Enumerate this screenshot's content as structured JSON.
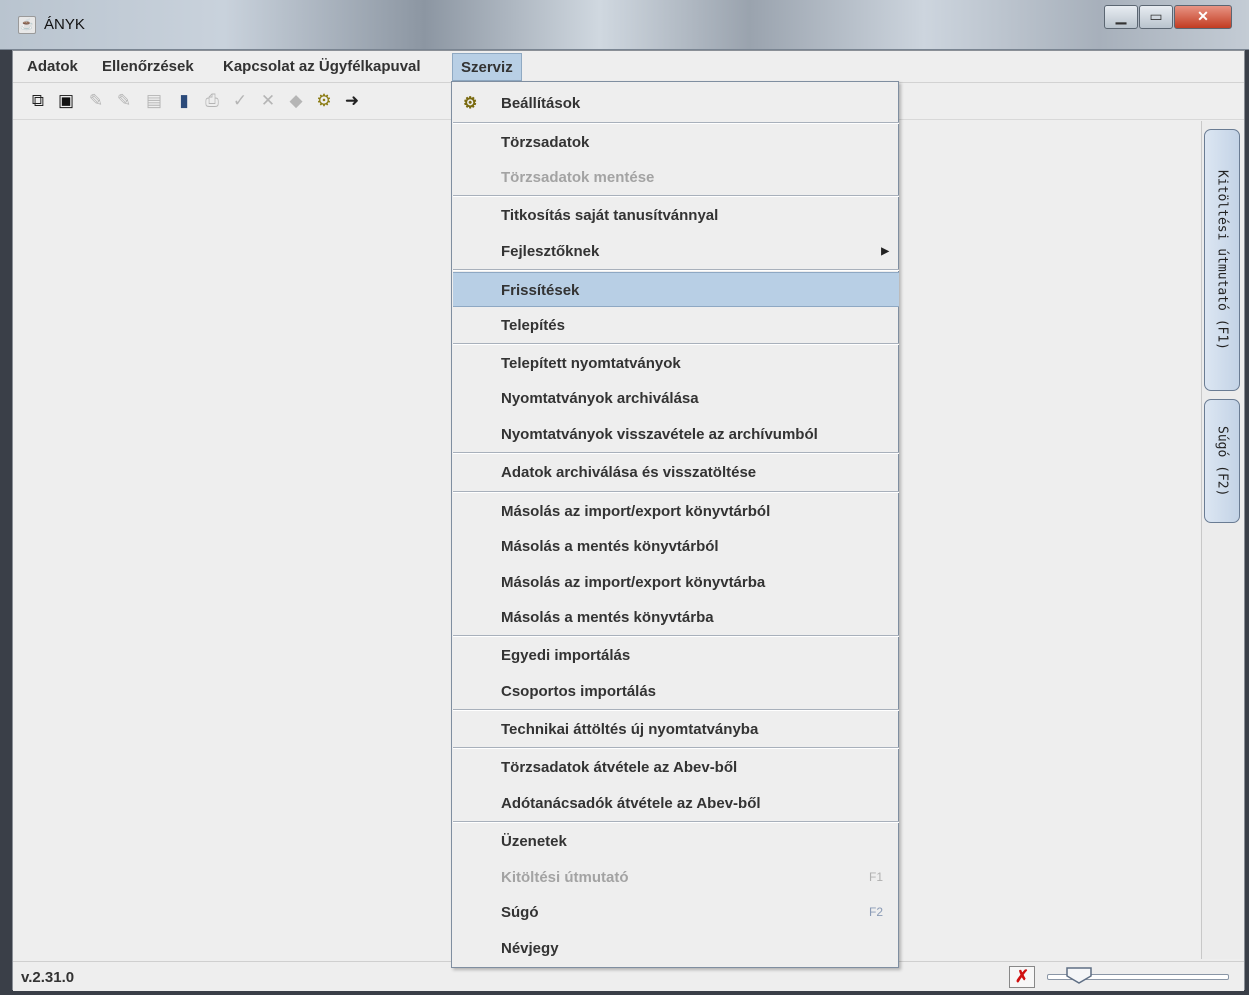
{
  "window": {
    "title": "ÁNYK"
  },
  "menubar": {
    "items": [
      "Adatok",
      "Ellenőrzések",
      "Kapcsolat az Ügyfélkapuval",
      "Szerviz"
    ]
  },
  "toolbar": {
    "icons": [
      "copy-icon",
      "save-icon",
      "edit-icon",
      "edit-icon",
      "print-preview-icon",
      "info-icon",
      "print-icon",
      "check-icon",
      "delete-icon",
      "stamp-icon",
      "gears-icon",
      "export-icon"
    ]
  },
  "side_tabs": {
    "guide": "Kitöltési útmutató (F1)",
    "help": "Súgó (F2)"
  },
  "status": {
    "version": "v.2.31.0"
  },
  "dropdown": {
    "items": {
      "beallitasok": "Beállítások",
      "torzsadatok": "Törzsadatok",
      "torzsadatok_mentese": "Törzsadatok mentése",
      "titkositas": "Titkosítás saját tanusítvánnyal",
      "fejlesztoknek": "Fejlesztőknek",
      "frissitesek": "Frissítések",
      "telepites": "Telepítés",
      "telepitett": "Telepített nyomtatványok",
      "archivalasa": "Nyomtatványok archiválása",
      "visszavetele": "Nyomtatványok visszavétele az archívumból",
      "adatok_archivalasa": "Adatok archiválása és visszatöltése",
      "masolas_import_bol": "Másolás az import/export könyvtárból",
      "masolas_mentes_bol": "Másolás a mentés könyvtárból",
      "masolas_import_ba": "Másolás az import/export könyvtárba",
      "masolas_mentes_ba": "Másolás a mentés könyvtárba",
      "egyedi_import": "Egyedi importálás",
      "csoportos_import": "Csoportos importálás",
      "technikai": "Technikai áttöltés új nyomtatványba",
      "torzsadatok_abev": "Törzsadatok átvétele az Abev-ből",
      "adotanacsadok_abev": "Adótanácsadók átvétele az Abev-ből",
      "uzenetek": "Üzenetek",
      "kitoltesi": "Kitöltési útmutató",
      "sugo": "Súgó",
      "nevjegy": "Névjegy"
    },
    "shortcuts": {
      "kitoltesi": "F1",
      "sugo": "F2"
    }
  },
  "colors": {
    "highlight": "#b8cfe5",
    "disabled_text": "#a3a3a3"
  }
}
